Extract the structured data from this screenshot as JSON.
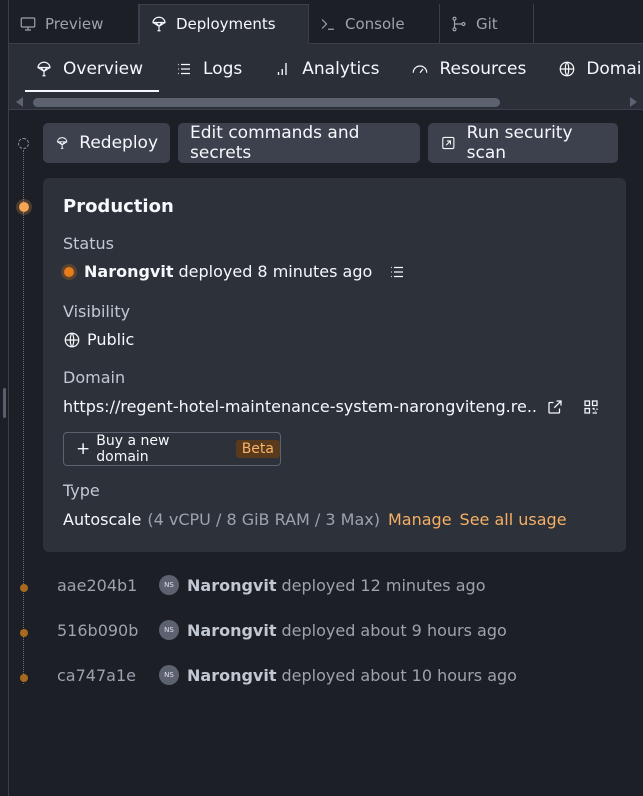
{
  "window_tabs": [
    {
      "label": "Preview",
      "icon": "monitor-icon"
    },
    {
      "label": "Deployments",
      "icon": "deploy-icon"
    },
    {
      "label": "Console",
      "icon": "terminal-icon"
    },
    {
      "label": "Git",
      "icon": "git-icon"
    }
  ],
  "subnav": [
    {
      "label": "Overview",
      "icon": "deploy-icon"
    },
    {
      "label": "Logs",
      "icon": "list-icon"
    },
    {
      "label": "Analytics",
      "icon": "bar-chart-icon"
    },
    {
      "label": "Resources",
      "icon": "gauge-icon"
    },
    {
      "label": "Domains",
      "icon": "globe-icon"
    }
  ],
  "actions": {
    "redeploy": "Redeploy",
    "edit": "Edit commands and secrets",
    "security": "Run security scan"
  },
  "production": {
    "title": "Production",
    "status_label": "Status",
    "status_user": "Narongvit",
    "status_text": "deployed 8 minutes ago",
    "visibility_label": "Visibility",
    "visibility_value": "Public",
    "domain_label": "Domain",
    "domain_value": "https://regent-hotel-maintenance-system-narongviteng.re...",
    "buy_domain": "Buy a new domain",
    "beta": "Beta",
    "type_label": "Type",
    "type_value": "Autoscale",
    "type_detail": "(4 vCPU / 8 GiB RAM / 3 Max)",
    "manage": "Manage",
    "see_usage": "See all usage"
  },
  "history": [
    {
      "hash": "aae204b1",
      "initials": "NS",
      "user": "Narongvit",
      "text": "deployed 12 minutes ago"
    },
    {
      "hash": "516b090b",
      "initials": "NS",
      "user": "Narongvit",
      "text": "deployed about 9 hours ago"
    },
    {
      "hash": "ca747a1e",
      "initials": "NS",
      "user": "Narongvit",
      "text": "deployed about 10 hours ago"
    }
  ],
  "colors": {
    "accent": "#f5a453",
    "status": "#e87b1a",
    "link": "#f5b066"
  }
}
